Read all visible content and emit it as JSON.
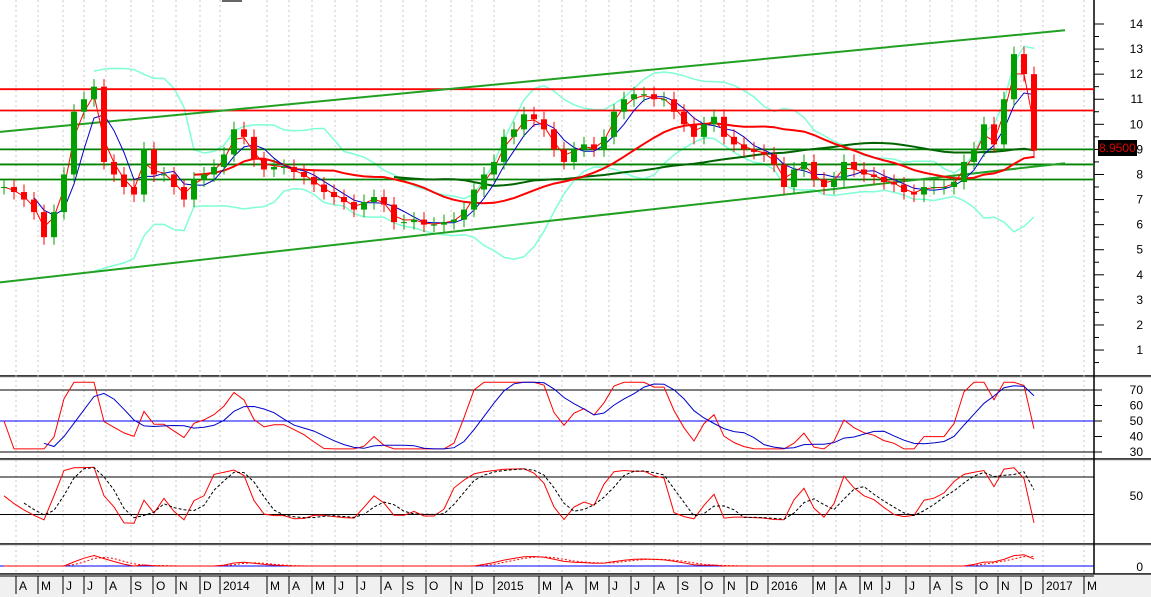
{
  "chart_data": {
    "type": "candlestick",
    "title": "",
    "last_price_label": "8.9500",
    "price_axis": {
      "ylim": [
        0,
        14.6
      ],
      "ticks": [
        1,
        2,
        3,
        4,
        5,
        6,
        7,
        8,
        9,
        10,
        11,
        12,
        13,
        14
      ]
    },
    "x_labels": [
      "A",
      "M",
      "J",
      "J",
      "A",
      "S",
      "O",
      "N",
      "D",
      "2014",
      "M",
      "A",
      "M",
      "J",
      "J",
      "A",
      "S",
      "O",
      "N",
      "D",
      "2015",
      "M",
      "A",
      "M",
      "J",
      "J",
      "A",
      "S",
      "O",
      "N",
      "D",
      "2016",
      "M",
      "A",
      "M",
      "J",
      "J",
      "A",
      "S",
      "O",
      "N",
      "D",
      "2017",
      "M"
    ],
    "closes": [
      7.5,
      7.3,
      7.0,
      6.5,
      5.5,
      6.5,
      8.0,
      10.5,
      11.0,
      11.5,
      8.5,
      8.0,
      7.5,
      7.2,
      9.0,
      8.0,
      8.0,
      7.5,
      7.0,
      7.8,
      8.0,
      8.3,
      8.8,
      9.8,
      9.5,
      8.6,
      8.2,
      8.3,
      8.3,
      8.1,
      7.9,
      7.6,
      7.3,
      7.1,
      6.9,
      6.6,
      6.9,
      7.1,
      6.8,
      6.1,
      6.1,
      6.2,
      6.0,
      6.0,
      6.1,
      6.2,
      6.6,
      7.4,
      8.0,
      8.5,
      9.5,
      9.8,
      10.4,
      10.2,
      9.8,
      9.0,
      8.5,
      9.0,
      9.2,
      9.0,
      9.5,
      10.5,
      11.0,
      11.2,
      11.2,
      11.0,
      11.0,
      10.5,
      10.0,
      9.5,
      10.0,
      10.3,
      9.5,
      9.2,
      9.0,
      8.9,
      8.8,
      8.4,
      7.5,
      8.2,
      8.5,
      7.8,
      7.5,
      7.8,
      8.5,
      8.2,
      8.0,
      7.9,
      7.7,
      7.6,
      7.3,
      7.2,
      7.5,
      7.5,
      7.5,
      7.7,
      8.5,
      9.0,
      10.0,
      9.2,
      11.0,
      12.8,
      12.0,
      8.95
    ],
    "horizontal_lines": [
      {
        "price": 11.4,
        "color": "#ff0000"
      },
      {
        "price": 10.55,
        "color": "#ff0000"
      },
      {
        "price": 9.0,
        "color": "#008000"
      },
      {
        "price": 8.4,
        "color": "#008000"
      },
      {
        "price": 7.8,
        "color": "#008000"
      }
    ],
    "trend_lines": [
      {
        "from": [
          0,
          9.7
        ],
        "to": [
          1,
          13.75
        ],
        "color": "#22a022"
      },
      {
        "from": [
          0,
          3.7
        ],
        "to": [
          1,
          8.45
        ],
        "color": "#22a022"
      }
    ],
    "indicators": {
      "rsi": {
        "ticks": [
          30,
          40,
          50,
          60,
          70
        ],
        "levels": [
          70,
          50,
          30
        ]
      },
      "stochastic": {
        "ticks": [
          50
        ],
        "levels": [
          80,
          20
        ]
      },
      "macd": {
        "ticks": [
          0
        ]
      }
    },
    "colors": {
      "up": "#00a000",
      "down": "#ff0000",
      "ma_short": "#0000cc",
      "ma_fast": "#ff0000",
      "ma_long": "#ff0000",
      "ma_very_long": "#006400",
      "bollinger": "#7fffd4"
    }
  }
}
